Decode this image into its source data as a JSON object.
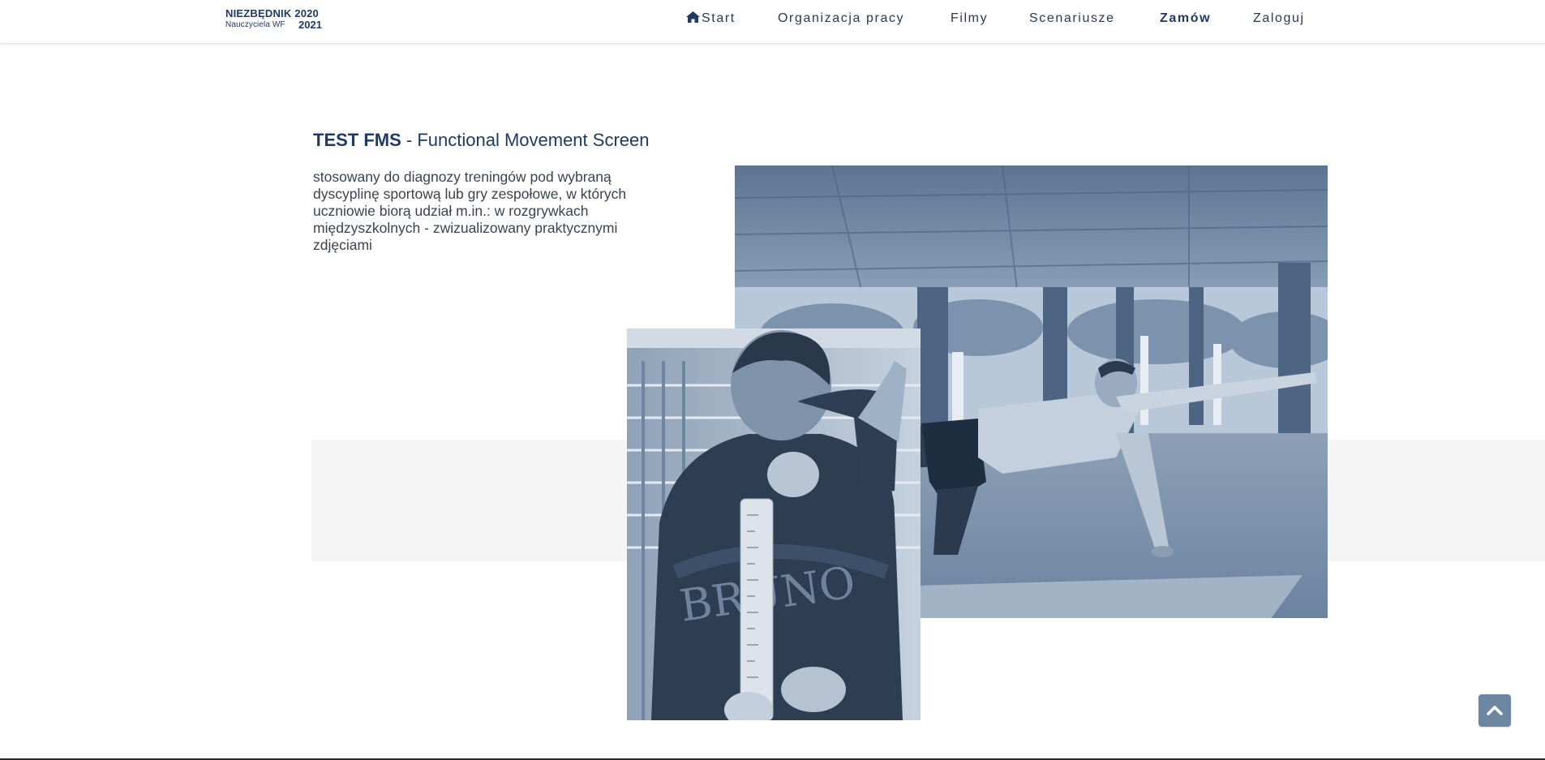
{
  "header": {
    "logo": {
      "line1": "NIEZBĘDNIK 2020",
      "line2": "Nauczyciela WF",
      "year2": "2021"
    },
    "nav": [
      {
        "label": "Start",
        "icon": "home-icon"
      },
      {
        "label": "Organizacja pracy"
      },
      {
        "label": "Filmy"
      },
      {
        "label": "Scenariusze"
      },
      {
        "label": "Zamów",
        "active": true
      },
      {
        "label": "Zaloguj"
      }
    ]
  },
  "main": {
    "title_bold": "TEST FMS",
    "title_rest": " - Functional Movement Screen",
    "description": "stosowany do diagnozy treningów pod wybraną dyscyplinę sportową lub gry zespołowe, w których uczniowie biorą udział m.in.: w rozgrywkach międzyszkolnych - zwizualizowany praktycznymi zdjęciami",
    "jersey_text": "BRUNO"
  },
  "colors": {
    "brand": "#1f3a63",
    "text": "#3b4350",
    "band": "#f5f5f5",
    "scroll_button": "#6d87a3",
    "photo_tint": "#4f6a8c"
  },
  "icons": {
    "scroll_top": "chevron-up-icon"
  }
}
